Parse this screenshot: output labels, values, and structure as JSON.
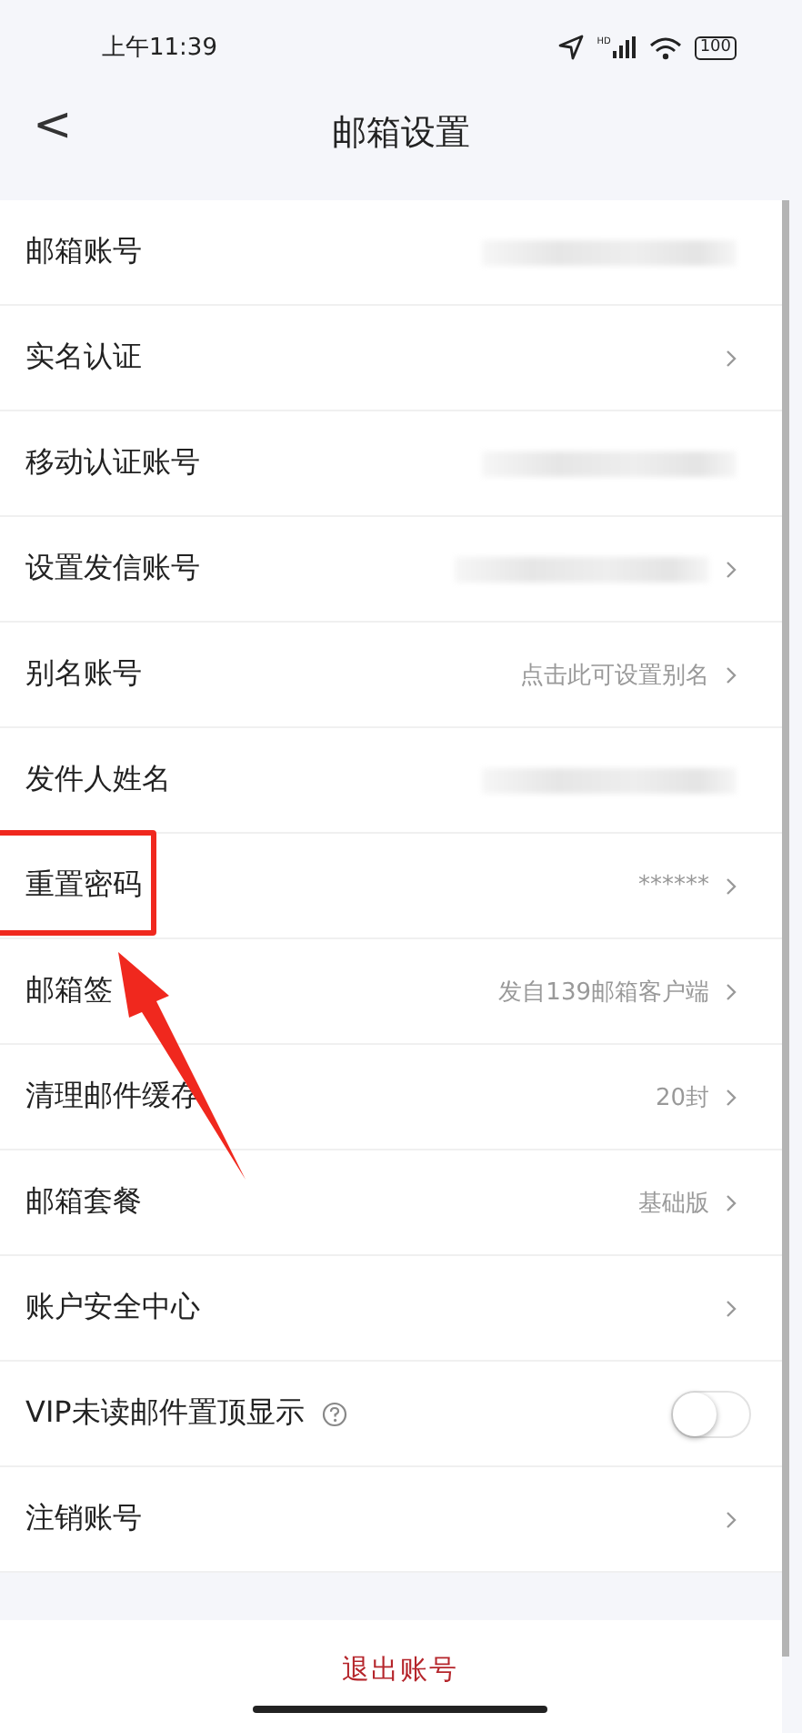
{
  "status_bar": {
    "time": "上午11:39",
    "signal_label": "HD",
    "battery": "100"
  },
  "header": {
    "back": "<",
    "title": "邮箱设置"
  },
  "rows": [
    {
      "kind": "value",
      "label": "邮箱账号",
      "blurred": true,
      "chevron": false,
      "highlighted": false
    },
    {
      "kind": "value",
      "label": "实名认证",
      "chevron": true,
      "highlighted": false
    },
    {
      "kind": "value",
      "label": "移动认证账号",
      "blurred": true,
      "chevron": false,
      "highlighted": false
    },
    {
      "kind": "value",
      "label": "设置发信账号",
      "blurred": true,
      "chevron": true,
      "highlighted": false
    },
    {
      "kind": "value",
      "label": "别名账号",
      "value": "点击此可设置别名",
      "chevron": true,
      "highlighted": false
    },
    {
      "kind": "value",
      "label": "发件人姓名",
      "blurred": true,
      "chevron": false,
      "highlighted": false
    },
    {
      "kind": "value",
      "label": "重置密码",
      "value": "******",
      "chevron": true,
      "highlighted": true
    },
    {
      "kind": "value",
      "label": "邮箱签",
      "value": "发自139邮箱客户端",
      "chevron": true,
      "highlighted": false
    },
    {
      "kind": "value",
      "label": "清理邮件缓存",
      "value": "20封",
      "chevron": true,
      "highlighted": false
    },
    {
      "kind": "value",
      "label": "邮箱套餐",
      "value": "基础版",
      "chevron": true,
      "highlighted": false
    },
    {
      "kind": "value",
      "label": "账户安全中心",
      "chevron": true,
      "highlighted": false
    },
    {
      "kind": "toggle",
      "label": "VIP未读邮件置顶显示",
      "help": true,
      "on": false,
      "highlighted": false
    },
    {
      "kind": "value",
      "label": "注销账号",
      "chevron": true,
      "highlighted": false
    }
  ],
  "logout": {
    "label": "退出账号"
  }
}
